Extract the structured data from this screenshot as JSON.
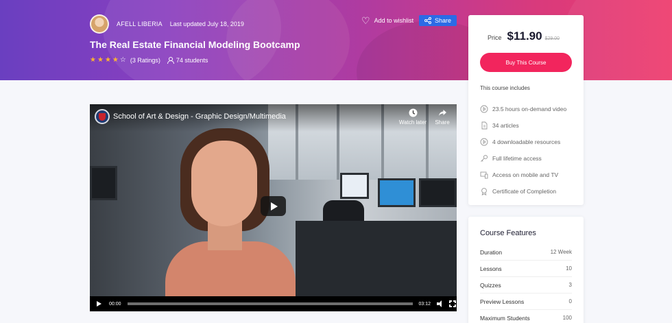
{
  "author": {
    "name": "AFELL LIBERIA",
    "updated": "Last updated July 18, 2019"
  },
  "course": {
    "title": "The Real Estate Financial Modeling Bootcamp",
    "rating": 3.5,
    "rating_count": "(3 Ratings)",
    "students": "74 students"
  },
  "actions": {
    "wishlist_label": "Add to wishlist",
    "share_label": "Share"
  },
  "video": {
    "title": "School of Art & Design - Graphic Design/Multimedia",
    "watch_later": "Watch later",
    "share": "Share",
    "current_time": "00:00",
    "duration": "03:12",
    "progress": 0
  },
  "pricing": {
    "label": "Price",
    "price": "$11.90",
    "old_price": "$29.00",
    "buy_label": "Buy This Course",
    "includes_title": "This course includes",
    "includes": [
      {
        "icon": "play-circle-icon",
        "label": "23.5 hours on-demand video"
      },
      {
        "icon": "document-icon",
        "label": "34 articles"
      },
      {
        "icon": "download-circle-icon",
        "label": "4 downloadable resources"
      },
      {
        "icon": "key-icon",
        "label": "Full lifetime access"
      },
      {
        "icon": "devices-icon",
        "label": "Access on mobile and TV"
      },
      {
        "icon": "certificate-icon",
        "label": "Certificate of Completion"
      }
    ]
  },
  "features": {
    "title": "Course Features",
    "items": [
      {
        "label": "Duration",
        "value": "12 Week"
      },
      {
        "label": "Lessons",
        "value": "10"
      },
      {
        "label": "Quizzes",
        "value": "3"
      },
      {
        "label": "Preview Lessons",
        "value": "0"
      },
      {
        "label": "Maximum Students",
        "value": "100"
      }
    ]
  },
  "colors": {
    "accent": "#f2255d",
    "share_blue": "#2b6be6",
    "star": "#ffb52e"
  }
}
